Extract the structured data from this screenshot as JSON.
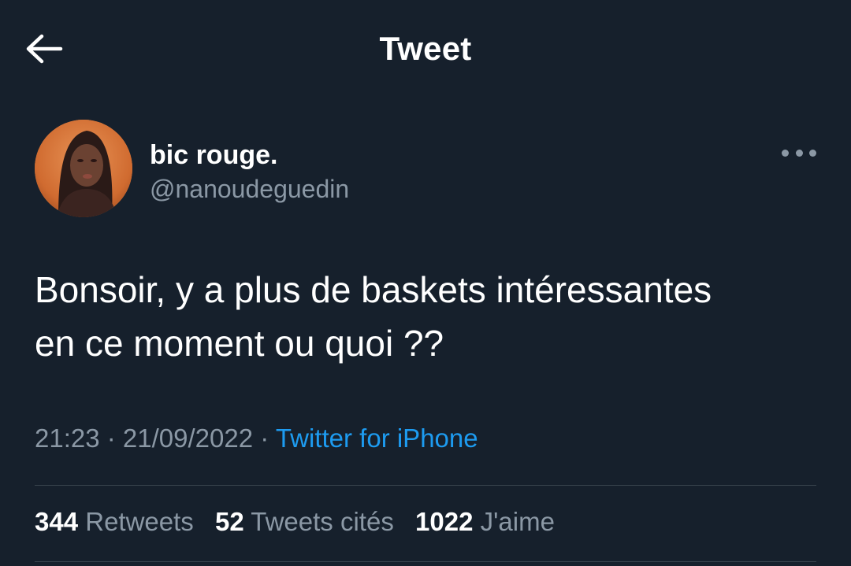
{
  "header": {
    "title": "Tweet",
    "back_icon": "arrow-left-icon"
  },
  "author": {
    "display_name": "bic rouge.",
    "handle": "@nanoudeguedin",
    "avatar_icon": "profile-photo"
  },
  "more_icon": "more-horizontal-icon",
  "tweet": {
    "text_line1": "Bonsoir, y a plus de baskets intéressantes",
    "text_line2": "en ce moment ou quoi ??"
  },
  "meta": {
    "time": "21:23",
    "separator1": " · ",
    "date": "21/09/2022",
    "separator2": " · ",
    "source": "Twitter for iPhone"
  },
  "stats": {
    "retweets_count": "344",
    "retweets_label": "Retweets",
    "quotes_count": "52",
    "quotes_label": "Tweets cités",
    "likes_count": "1022",
    "likes_label": "J'aime"
  },
  "colors": {
    "background": "#16202c",
    "secondary_text": "#8b98a5",
    "link": "#1d9bf0",
    "divider": "#38444d"
  }
}
